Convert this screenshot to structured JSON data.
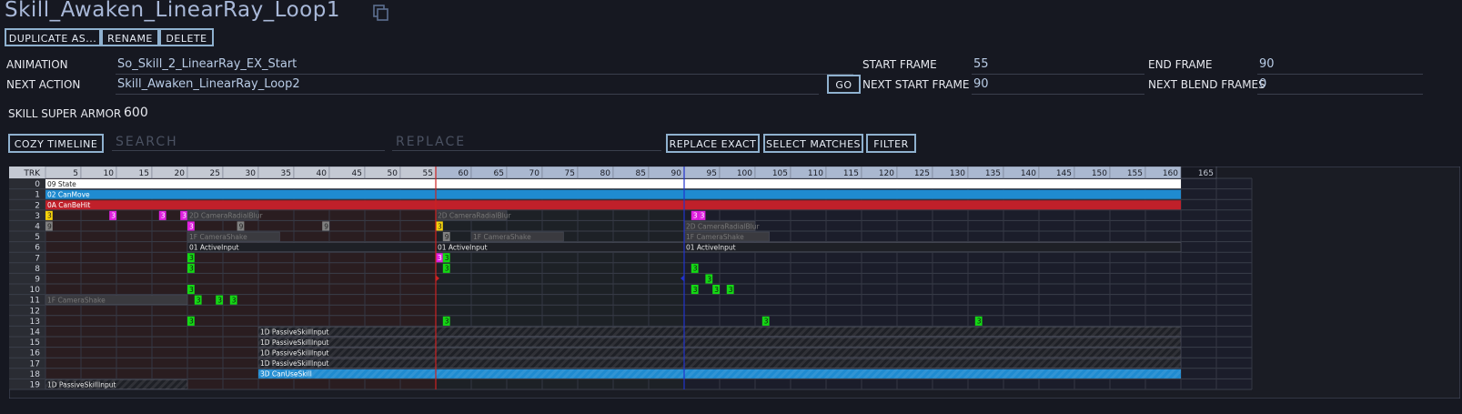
{
  "header": {
    "title": "Skill_Awaken_LinearRay_Loop1"
  },
  "actions": {
    "duplicate": "DUPLICATE AS...",
    "rename": "RENAME",
    "delete": "DELETE"
  },
  "props": {
    "animation_label": "ANIMATION",
    "animation_value": "So_Skill_2_LinearRay_EX_Start",
    "next_action_label": "NEXT ACTION",
    "next_action_value": "Skill_Awaken_LinearRay_Loop2",
    "go_label": "GO",
    "start_frame_label": "START FRAME",
    "start_frame_value": "55",
    "next_start_frame_label": "NEXT START FRAME",
    "next_start_frame_value": "90",
    "end_frame_label": "END FRAME",
    "end_frame_value": "90",
    "next_blend_frames_label": "NEXT BLEND FRAMES",
    "next_blend_frames_value": "0",
    "super_armor_label": "SKILL SUPER ARMOR",
    "super_armor_value": "600"
  },
  "toolbar": {
    "cozy": "COZY TIMELINE",
    "search_placeholder": "SEARCH",
    "replace_placeholder": "REPLACE",
    "replace_exact": "REPLACE EXACT",
    "select_matches": "SELECT MATCHES",
    "filter": "FILTER"
  },
  "timeline": {
    "header_label": "TRK",
    "frame_ticks": [
      "5",
      "10",
      "15",
      "20",
      "25",
      "30",
      "35",
      "40",
      "45",
      "50",
      "55",
      "60",
      "65",
      "70",
      "75",
      "80",
      "85",
      "90",
      "95",
      "100",
      "105",
      "110",
      "115",
      "120",
      "125",
      "130",
      "135",
      "140",
      "145",
      "150",
      "155",
      "160",
      "165"
    ],
    "track_numbers": [
      "0",
      "1",
      "2",
      "3",
      "4",
      "5",
      "6",
      "7",
      "8",
      "9",
      "10",
      "11",
      "12",
      "13",
      "14",
      "15",
      "16",
      "17",
      "18",
      "19"
    ],
    "playhead_frame": 55,
    "marker_frame": 90,
    "colors": {
      "playhead": "#cc2222",
      "marker": "#2233cc"
    },
    "events": [
      {
        "track": 0,
        "start": 0,
        "end": 160,
        "label": "09 State",
        "color": "#ffffff",
        "text": "#222222"
      },
      {
        "track": 1,
        "start": 0,
        "end": 160,
        "label": "02 CanMove",
        "color": "#1f8bd0",
        "text": "#ffffff"
      },
      {
        "track": 2,
        "start": 0,
        "end": 160,
        "label": "0A CanBeHit",
        "color": "#c0202a",
        "text": "#ffffff"
      },
      {
        "track": 3,
        "start": 0,
        "end": 1,
        "label": "3",
        "color": "#f5d20a",
        "text": "#222222"
      },
      {
        "track": 3,
        "start": 9,
        "end": 10,
        "label": "3",
        "color": "#e020e0",
        "text": "#ffffff"
      },
      {
        "track": 3,
        "start": 16,
        "end": 17,
        "label": "3",
        "color": "#e020e0",
        "text": "#ffffff"
      },
      {
        "track": 3,
        "start": 19,
        "end": 20,
        "label": "3",
        "color": "#e020e0",
        "text": "#ffffff"
      },
      {
        "track": 3,
        "start": 20,
        "end": 30,
        "label": "2D CameraRadialBlur",
        "color": "#3a3a3f",
        "text": "#777777"
      },
      {
        "track": 3,
        "start": 55,
        "end": 65,
        "label": "2D CameraRadialBlur",
        "color": "#3a3a3f",
        "text": "#777777"
      },
      {
        "track": 3,
        "start": 91,
        "end": 92,
        "label": "3",
        "color": "#e020e0",
        "text": "#ffffff"
      },
      {
        "track": 3,
        "start": 92,
        "end": 93,
        "label": "3",
        "color": "#e020e0",
        "text": "#ffffff"
      },
      {
        "track": 4,
        "start": 0,
        "end": 1,
        "label": "9",
        "color": "#808080",
        "text": "#222222"
      },
      {
        "track": 4,
        "start": 20,
        "end": 21,
        "label": "3",
        "color": "#e020e0",
        "text": "#ffffff"
      },
      {
        "track": 4,
        "start": 27,
        "end": 28,
        "label": "9",
        "color": "#808080",
        "text": "#222222"
      },
      {
        "track": 4,
        "start": 39,
        "end": 40,
        "label": "9",
        "color": "#808080",
        "text": "#222222"
      },
      {
        "track": 4,
        "start": 55,
        "end": 56,
        "label": "3",
        "color": "#f5d20a",
        "text": "#222222"
      },
      {
        "track": 4,
        "start": 90,
        "end": 100,
        "label": "2D CameraRadialBlur",
        "color": "#3a3a3f",
        "text": "#777777"
      },
      {
        "track": 5,
        "start": 20,
        "end": 33,
        "label": "1F CameraShake",
        "color": "#3a3a3f",
        "text": "#777777"
      },
      {
        "track": 5,
        "start": 56,
        "end": 57,
        "label": "9",
        "color": "#808080",
        "text": "#222222"
      },
      {
        "track": 5,
        "start": 60,
        "end": 73,
        "label": "1F CameraShake",
        "color": "#3a3a3f",
        "text": "#777777"
      },
      {
        "track": 5,
        "start": 90,
        "end": 102,
        "label": "1F CameraShake",
        "color": "#3a3a3f",
        "text": "#777777"
      },
      {
        "track": 6,
        "start": 20,
        "end": 160,
        "label": "01 ActiveInput",
        "color": "#1e2026",
        "text": "#e6e6e6"
      },
      {
        "track": 6,
        "start": 55,
        "end": 160,
        "label": "01 ActiveInput",
        "color": "#1e2026",
        "text": "#e6e6e6"
      },
      {
        "track": 6,
        "start": 90,
        "end": 160,
        "label": "01 ActiveInput",
        "color": "#1e2026",
        "text": "#e6e6e6"
      },
      {
        "track": 7,
        "start": 20,
        "end": 21,
        "label": "3",
        "color": "#14d814",
        "text": "#111111"
      },
      {
        "track": 7,
        "start": 55,
        "end": 56,
        "label": "3",
        "color": "#e020e0",
        "text": "#ffffff"
      },
      {
        "track": 7,
        "start": 56,
        "end": 57,
        "label": "3",
        "color": "#14d814",
        "text": "#111111"
      },
      {
        "track": 8,
        "start": 20,
        "end": 21,
        "label": "3",
        "color": "#14d814",
        "text": "#111111"
      },
      {
        "track": 8,
        "start": 56,
        "end": 57,
        "label": "3",
        "color": "#14d814",
        "text": "#111111"
      },
      {
        "track": 8,
        "start": 91,
        "end": 92,
        "label": "3",
        "color": "#14d814",
        "text": "#111111"
      },
      {
        "track": 9,
        "start": 93,
        "end": 94,
        "label": "3",
        "color": "#14d814",
        "text": "#111111"
      },
      {
        "track": 10,
        "start": 20,
        "end": 21,
        "label": "3",
        "color": "#14d814",
        "text": "#111111"
      },
      {
        "track": 10,
        "start": 91,
        "end": 92,
        "label": "3",
        "color": "#14d814",
        "text": "#111111"
      },
      {
        "track": 10,
        "start": 94,
        "end": 95,
        "label": "3",
        "color": "#14d814",
        "text": "#111111"
      },
      {
        "track": 10,
        "start": 96,
        "end": 97,
        "label": "3",
        "color": "#14d814",
        "text": "#111111"
      },
      {
        "track": 11,
        "start": 0,
        "end": 20,
        "label": "1F CameraShake",
        "color": "#3a3a3f",
        "text": "#777777"
      },
      {
        "track": 11,
        "start": 21,
        "end": 22,
        "label": "3",
        "color": "#14d814",
        "text": "#111111"
      },
      {
        "track": 11,
        "start": 24,
        "end": 25,
        "label": "3",
        "color": "#14d814",
        "text": "#111111"
      },
      {
        "track": 11,
        "start": 26,
        "end": 27,
        "label": "3",
        "color": "#14d814",
        "text": "#111111"
      },
      {
        "track": 13,
        "start": 20,
        "end": 21,
        "label": "3",
        "color": "#14d814",
        "text": "#111111"
      },
      {
        "track": 13,
        "start": 56,
        "end": 57,
        "label": "3",
        "color": "#14d814",
        "text": "#111111"
      },
      {
        "track": 13,
        "start": 101,
        "end": 102,
        "label": "3",
        "color": "#14d814",
        "text": "#111111"
      },
      {
        "track": 13,
        "start": 131,
        "end": 132,
        "label": "3",
        "color": "#14d814",
        "text": "#111111"
      },
      {
        "track": 14,
        "start": 30,
        "end": 160,
        "label": "1D PassiveSkillInput",
        "color": "#1e2026",
        "text": "#e6e6e6",
        "striped": true
      },
      {
        "track": 15,
        "start": 30,
        "end": 160,
        "label": "1D PassiveSkillInput",
        "color": "#1e2026",
        "text": "#e6e6e6",
        "striped": true
      },
      {
        "track": 16,
        "start": 30,
        "end": 160,
        "label": "1D PassiveSkillInput",
        "color": "#1e2026",
        "text": "#e6e6e6",
        "striped": true
      },
      {
        "track": 17,
        "start": 30,
        "end": 160,
        "label": "1D PassiveSkillInput",
        "color": "#1e2026",
        "text": "#e6e6e6",
        "striped": true
      },
      {
        "track": 18,
        "start": 30,
        "end": 160,
        "label": "3D CanUseSkill",
        "color": "#1f8bd0",
        "text": "#ffffff",
        "striped": true
      },
      {
        "track": 19,
        "start": 0,
        "end": 20,
        "label": "1D PassiveSkillInput",
        "color": "#1e2026",
        "text": "#e6e6e6",
        "striped": true
      }
    ]
  }
}
